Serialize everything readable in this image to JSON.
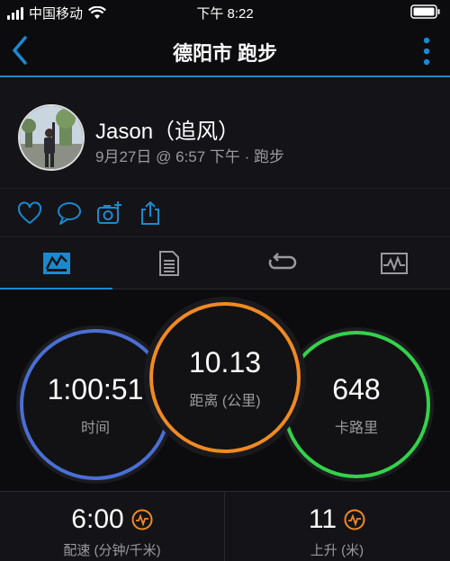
{
  "status_bar": {
    "carrier": "中国移动",
    "time": "下午 8:22"
  },
  "nav": {
    "title": "德阳市 跑步"
  },
  "profile": {
    "name": "Jason（追风）",
    "meta": "9月27日 @ 6:57 下午 · 跑步"
  },
  "icons": {
    "back": "chevron-left-icon",
    "menu": "more-vertical-icon",
    "like": "heart-icon",
    "comment": "comment-icon",
    "photo": "add-photo-icon",
    "share": "share-icon",
    "tab_overview": "overview-map-icon",
    "tab_stats": "document-list-icon",
    "tab_laps": "laps-loop-icon",
    "tab_charts": "chart-icon"
  },
  "summary": {
    "time": {
      "value": "1:00:51",
      "label": "时间"
    },
    "distance": {
      "value": "10.13",
      "label": "距离 (公里)"
    },
    "calories": {
      "value": "648",
      "label": "卡路里"
    }
  },
  "stats": {
    "pace": {
      "value": "6:00",
      "label": "配速 (分钟/千米)"
    },
    "ascent": {
      "value": "11",
      "label": "上升 (米)"
    }
  },
  "colors": {
    "accent": "#1a8ad0",
    "time_ring": "#4a6fd4",
    "distance_ring": "#f08a22",
    "calories_ring": "#33d24a",
    "stat_icon": "#f08a22"
  }
}
